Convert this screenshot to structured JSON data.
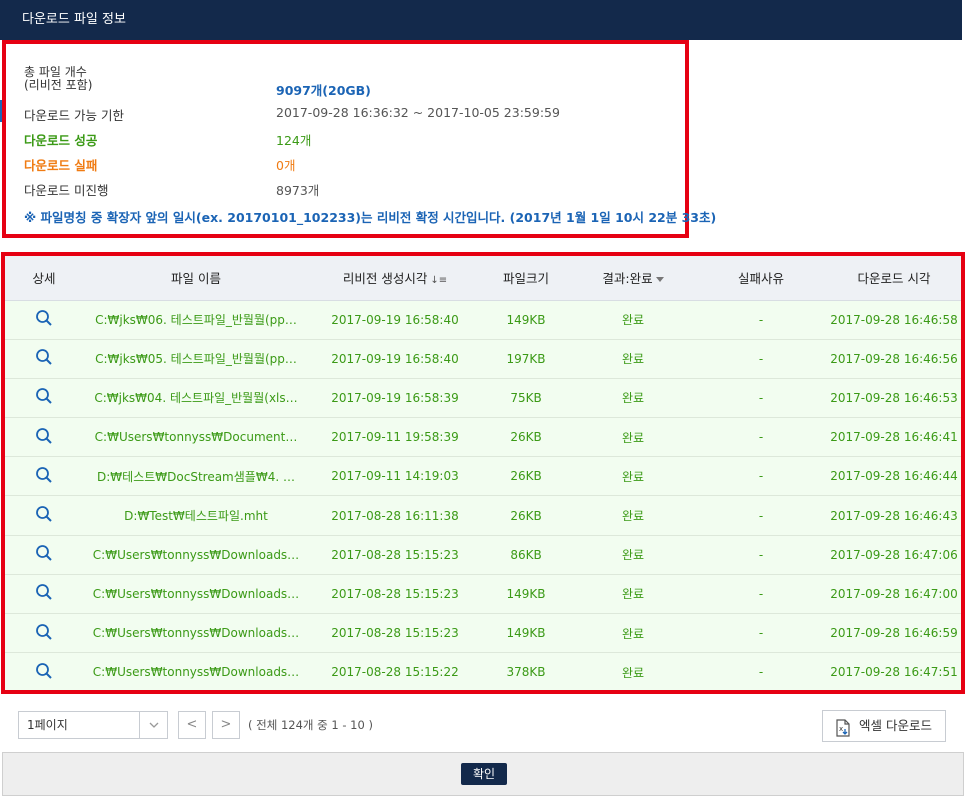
{
  "window": {
    "title": "다운로드 파일 정보"
  },
  "summary": {
    "total_label_1": "총 파일 개수",
    "total_label_2": "(리비전 포함)",
    "total_value": "9097개(20GB)",
    "period_label": "다운로드 가능 기한",
    "period_value": "2017-09-28 16:36:32 ~ 2017-10-05 23:59:59",
    "success_label": "다운로드 성공",
    "success_value": "124개",
    "fail_label": "다운로드 실패",
    "fail_value": "0개",
    "pending_label": "다운로드 미진행",
    "pending_value": "8973개",
    "notice": "※ 파일명칭 중 확장자 앞의 일시(ex. 20170101_102233)는 리비전 확정 시간입니다. (2017년 1월 1일 10시 22분 33초)"
  },
  "table": {
    "headers": {
      "detail": "상세",
      "filename": "파일 이름",
      "revision_time": "리비전 생성시각",
      "size": "파일크기",
      "result": "결과:완료",
      "fail_reason": "실패사유",
      "download_time": "다운로드 시각"
    },
    "sort_icon": "↓≡",
    "rows": [
      {
        "filename": "C:₩jks₩06. 테스트파일_반뭘뭘(pp…",
        "revision_time": "2017-09-19 16:58:40",
        "size": "149KB",
        "result": "완료",
        "fail_reason": "-",
        "download_time": "2017-09-28 16:46:58"
      },
      {
        "filename": "C:₩jks₩05. 테스트파일_반뭘뭘(pp…",
        "revision_time": "2017-09-19 16:58:40",
        "size": "197KB",
        "result": "완료",
        "fail_reason": "-",
        "download_time": "2017-09-28 16:46:56"
      },
      {
        "filename": "C:₩jks₩04. 테스트파일_반뭘뭘(xls…",
        "revision_time": "2017-09-19 16:58:39",
        "size": "75KB",
        "result": "완료",
        "fail_reason": "-",
        "download_time": "2017-09-28 16:46:53"
      },
      {
        "filename": "C:₩Users₩tonnyss₩Document…",
        "revision_time": "2017-09-11 19:58:39",
        "size": "26KB",
        "result": "완료",
        "fail_reason": "-",
        "download_time": "2017-09-28 16:46:41"
      },
      {
        "filename": "D:₩테스트₩DocStream샘플₩4. …",
        "revision_time": "2017-09-11 14:19:03",
        "size": "26KB",
        "result": "완료",
        "fail_reason": "-",
        "download_time": "2017-09-28 16:46:44"
      },
      {
        "filename": "D:₩Test₩테스트파일.mht",
        "revision_time": "2017-08-28 16:11:38",
        "size": "26KB",
        "result": "완료",
        "fail_reason": "-",
        "download_time": "2017-09-28 16:46:43"
      },
      {
        "filename": "C:₩Users₩tonnyss₩Downloads…",
        "revision_time": "2017-08-28 15:15:23",
        "size": "86KB",
        "result": "완료",
        "fail_reason": "-",
        "download_time": "2017-09-28 16:47:06"
      },
      {
        "filename": "C:₩Users₩tonnyss₩Downloads…",
        "revision_time": "2017-08-28 15:15:23",
        "size": "149KB",
        "result": "완료",
        "fail_reason": "-",
        "download_time": "2017-09-28 16:47:00"
      },
      {
        "filename": "C:₩Users₩tonnyss₩Downloads…",
        "revision_time": "2017-08-28 15:15:23",
        "size": "149KB",
        "result": "완료",
        "fail_reason": "-",
        "download_time": "2017-09-28 16:46:59"
      },
      {
        "filename": "C:₩Users₩tonnyss₩Downloads…",
        "revision_time": "2017-08-28 15:15:22",
        "size": "378KB",
        "result": "완료",
        "fail_reason": "-",
        "download_time": "2017-09-28 16:47:51"
      }
    ]
  },
  "pagination": {
    "page_select": "1페이지",
    "prev": "<",
    "next": ">",
    "info": "( 전체 124개 중 1 - 10 )"
  },
  "actions": {
    "excel_label": "엑셀 다운로드",
    "ok_label": "확인"
  },
  "colors": {
    "titlebar": "#13294b",
    "highlight_border": "#e60012",
    "success_green": "#3b9a16",
    "fail_orange": "#f07b12",
    "link_blue": "#1b64b5",
    "row_bg": "#f2fdf0"
  },
  "icons": {
    "detail": "search-icon",
    "excel": "excel-file-icon",
    "dropdown": "chevron-down-icon"
  }
}
